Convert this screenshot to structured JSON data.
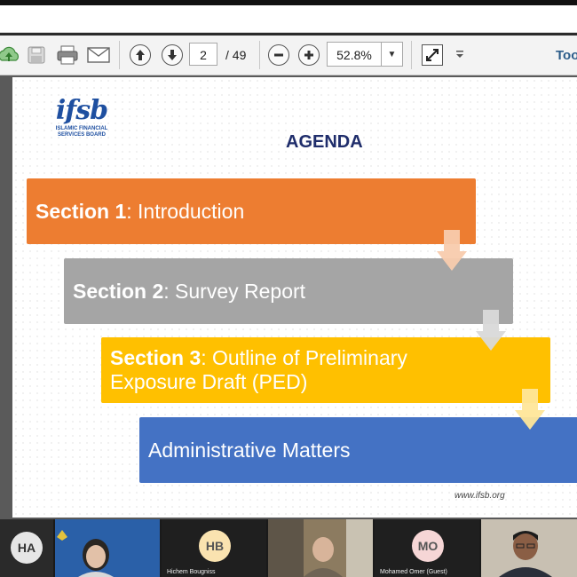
{
  "toolbar": {
    "page_current": "2",
    "page_total": "/ 49",
    "zoom": "52.8%",
    "tools_label": "Too"
  },
  "slide": {
    "logo_mark": "ifsb",
    "logo_line1": "ISLAMIC FINANCIAL",
    "logo_line2": "SERVICES BOARD",
    "title": "AGENDA",
    "items": [
      {
        "bold": "Section 1",
        "text": ": Introduction",
        "color": "#ED7D31"
      },
      {
        "bold": "Section 2",
        "text": ": Survey Report",
        "color": "#A5A5A5"
      },
      {
        "bold": "Section 3",
        "text": ": Outline of Preliminary",
        "text2": "Exposure Draft (PED)",
        "color": "#FFC000"
      },
      {
        "bold": "",
        "text": "Administrative Matters",
        "color": "#4472C4"
      }
    ],
    "website": "www.ifsb.org"
  },
  "participants": [
    {
      "initials": "HA",
      "name": ""
    },
    {
      "initials": "",
      "name": ""
    },
    {
      "initials": "HB",
      "name": "Hichem Bougniss"
    },
    {
      "initials": "",
      "name": ""
    },
    {
      "initials": "MO",
      "name": "Mohamed Omer (Guest)"
    },
    {
      "initials": "",
      "name": ""
    }
  ]
}
